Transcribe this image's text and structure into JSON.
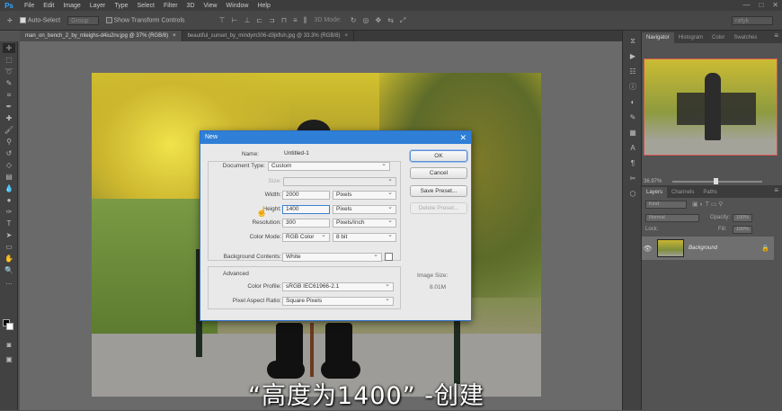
{
  "app": {
    "logo": "Ps"
  },
  "menu": [
    "File",
    "Edit",
    "Image",
    "Layer",
    "Type",
    "Select",
    "Filter",
    "3D",
    "View",
    "Window",
    "Help"
  ],
  "window_controls": [
    "—",
    "□",
    "✕"
  ],
  "options_bar": {
    "auto_select_label": "Auto-Select",
    "group_value": "Group",
    "transform_label": "Show Transform Controls",
    "mode_3d_label": "3D Mode:",
    "search_value": "rafyk"
  },
  "doc_tabs": [
    {
      "label": "man_on_bench_2_by_mleighs-d4iu2nv.jpg @ 37% (RGB/8)",
      "active": true
    },
    {
      "label": "beautiful_sunset_by_mindym306-d3jkflsh.jpg @ 33.3% (RGB/8)",
      "active": false
    }
  ],
  "caption": "“高度为1400” -创建",
  "dialog": {
    "title": "New",
    "name_label": "Name:",
    "name_value": "Untitled-1",
    "doc_type_label": "Document Type:",
    "doc_type_value": "Custom",
    "size_label": "Size:",
    "size_value": "",
    "width_label": "Width:",
    "width_value": "2000",
    "width_unit": "Pixels",
    "height_label": "Height:",
    "height_value": "1400",
    "height_unit": "Pixels",
    "resolution_label": "Resolution:",
    "resolution_value": "300",
    "resolution_unit": "Pixels/Inch",
    "color_mode_label": "Color Mode:",
    "color_mode_value": "RGB Color",
    "bit_depth_value": "8 bit",
    "bg_contents_label": "Background Contents:",
    "bg_contents_value": "White",
    "advanced_label": "Advanced",
    "color_profile_label": "Color Profile:",
    "color_profile_value": "sRGB IEC61966-2.1",
    "pixel_aspect_label": "Pixel Aspect Ratio:",
    "pixel_aspect_value": "Square Pixels",
    "image_size_label": "Image Size:",
    "image_size_value": "8.01M",
    "buttons": {
      "ok": "OK",
      "cancel": "Cancel",
      "save_preset": "Save Preset...",
      "delete_preset": "Delete Preset..."
    }
  },
  "navigator": {
    "tabs": [
      "Navigator",
      "Histogram",
      "Color",
      "Swatches"
    ],
    "zoom": "36.97%"
  },
  "layers_panel": {
    "tabs": [
      "Layers",
      "Channels",
      "Paths"
    ],
    "kind_label": "Kind",
    "blend_mode": "Normal",
    "opacity_label": "Opacity:",
    "opacity_value": "100%",
    "lock_label": "Lock:",
    "fill_label": "Fill:",
    "fill_value": "100%",
    "layer_name": "Background"
  }
}
